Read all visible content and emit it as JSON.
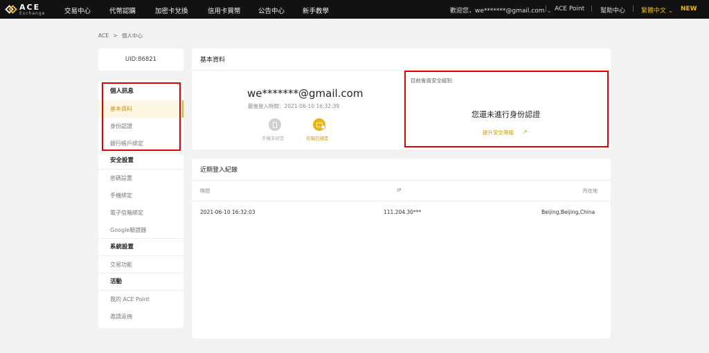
{
  "brand": {
    "name": "ACE",
    "sub": "Exchange"
  },
  "nav": {
    "items": [
      "交易中心",
      "代幣認購",
      "加密卡兌換",
      "信用卡買幣",
      "公告中心",
      "新手教學"
    ]
  },
  "topright": {
    "welcome": "歡迎您，we*******@gmail.com",
    "ace_point": "ACE Point",
    "help": "幫助中心",
    "language": "繁體中文",
    "new_badge": "NEW"
  },
  "breadcrumb": {
    "root": "ACE",
    "sep": ">",
    "current": "個人中心"
  },
  "uid": "UID:86821",
  "sidebar": {
    "sections": [
      {
        "title": "個人訊息",
        "items": [
          "基本資料",
          "身份認證",
          "銀行帳戶綁定"
        ]
      },
      {
        "title": "安全設置",
        "items": [
          "密碼設置",
          "手機綁定",
          "電子信箱綁定",
          "Google驗證器"
        ]
      },
      {
        "title": "系統設置",
        "items": [
          "交易功能"
        ]
      },
      {
        "title": "活動",
        "items": [
          "我的 ACE Point",
          "邀請返佣"
        ]
      }
    ],
    "active_item": "基本資料"
  },
  "basic_info": {
    "title": "基本資料",
    "email": "we*******@gmail.com",
    "last_login": "最後登入時間：2021-06-10 16:32:39",
    "phone_status": "手機未綁定",
    "email_status": "信箱已綁定"
  },
  "security": {
    "label": "目前會員安全級別",
    "status": "您還未進行身份認證",
    "upgrade": "提升安全等級",
    "upgrade_arrow": "↗"
  },
  "login_records": {
    "title": "近期登入紀錄",
    "headers": [
      "時間",
      "IP",
      "所在地"
    ],
    "rows": [
      [
        "2021-06-10 16:32:03",
        "111.204.30***",
        "Beijing,Beijing,China"
      ]
    ]
  },
  "colors": {
    "accent": "#e6b422",
    "highlight_box": "#e00000",
    "topbar": "#121212"
  }
}
